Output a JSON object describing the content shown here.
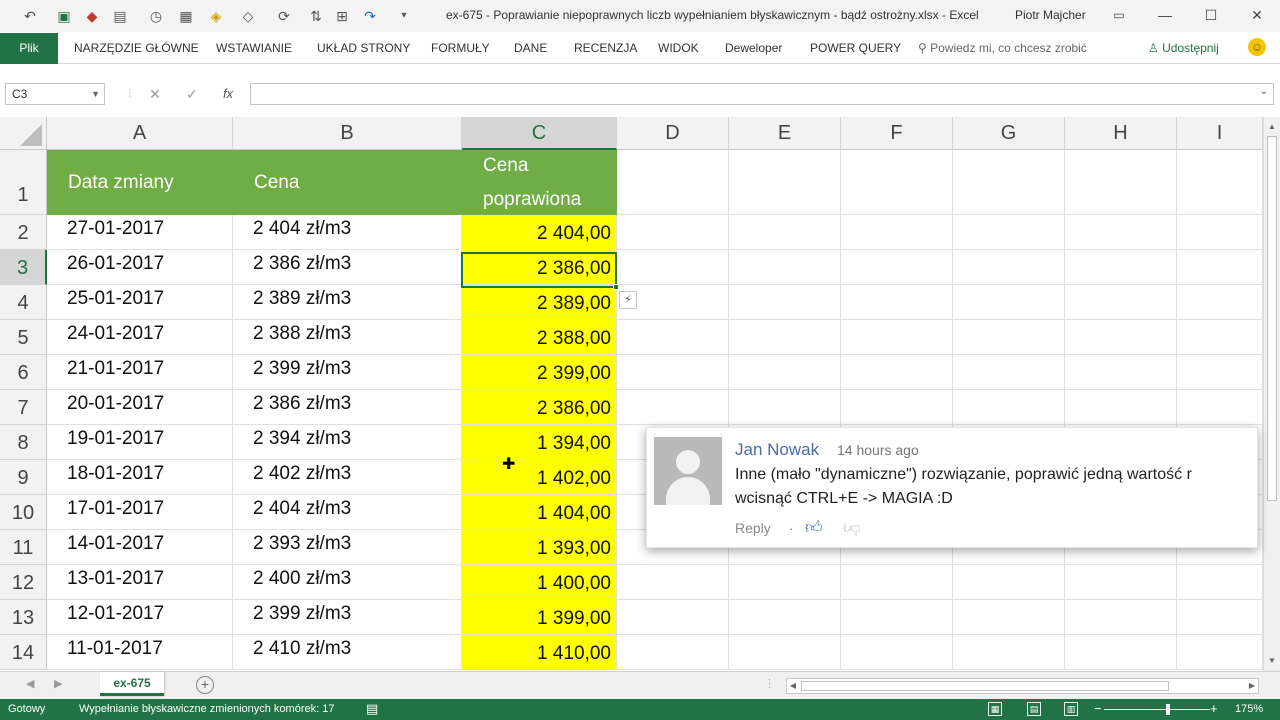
{
  "window": {
    "title": "ex-675 - Poprawianie niepoprawnych liczb wypełnianiem błyskawicznym - bądź ostrożny.xlsx  -  Excel",
    "user": "Piotr Majcher"
  },
  "ribbon": {
    "file": "Plik",
    "tabs": [
      "NARZĘDZIE GŁÓWNE",
      "WSTAWIANIE",
      "UKŁAD STRONY",
      "FORMUŁY",
      "DANE",
      "RECENZJA",
      "WIDOK",
      "Deweloper",
      "POWER QUERY"
    ],
    "tell_me": "Powiedz mi, co chcesz zrobić",
    "share": "Udostępnij"
  },
  "formula_bar": {
    "name_box": "C3",
    "cancel_glyph": "✕",
    "enter_glyph": "✓",
    "fx": "fx",
    "formula": ""
  },
  "columns": [
    "A",
    "B",
    "C",
    "D",
    "E",
    "F",
    "G",
    "H",
    "I"
  ],
  "selected_column": "C",
  "selected_row": 3,
  "sheet": {
    "header": {
      "a": "Data zmiany",
      "b": "Cena",
      "c1": "Cena",
      "c2": "poprawiona"
    },
    "rows": [
      {
        "n": 2,
        "a": "27-01-2017",
        "b": "2 404 zł/m3",
        "c": "2 404,00"
      },
      {
        "n": 3,
        "a": "26-01-2017",
        "b": "2 386 zł/m3",
        "c": "2 386,00"
      },
      {
        "n": 4,
        "a": "25-01-2017",
        "b": "2 389 zł/m3",
        "c": "2 389,00"
      },
      {
        "n": 5,
        "a": "24-01-2017",
        "b": "2 388 zł/m3",
        "c": "2 388,00"
      },
      {
        "n": 6,
        "a": "21-01-2017",
        "b": "2 399 zł/m3",
        "c": "2 399,00"
      },
      {
        "n": 7,
        "a": "20-01-2017",
        "b": "2 386 zł/m3",
        "c": "2 386,00"
      },
      {
        "n": 8,
        "a": "19-01-2017",
        "b": "2 394 zł/m3",
        "c": "1 394,00"
      },
      {
        "n": 9,
        "a": "18-01-2017",
        "b": "2 402 zł/m3",
        "c": "1 402,00"
      },
      {
        "n": 10,
        "a": "17-01-2017",
        "b": "2 404 zł/m3",
        "c": "1 404,00"
      },
      {
        "n": 11,
        "a": "14-01-2017",
        "b": "2 393 zł/m3",
        "c": "1 393,00"
      },
      {
        "n": 12,
        "a": "13-01-2017",
        "b": "2 400 zł/m3",
        "c": "1 400,00"
      },
      {
        "n": 13,
        "a": "12-01-2017",
        "b": "2 399 zł/m3",
        "c": "1 399,00"
      },
      {
        "n": 14,
        "a": "11-01-2017",
        "b": "2 410 zł/m3",
        "c": "1 410,00"
      }
    ]
  },
  "comment": {
    "author": "Jan Nowak",
    "time": "14 hours ago",
    "line1": "Inne (mało \"dynamiczne\") rozwiązanie, poprawić jedną wartość r",
    "line2": "wcisnąć CTRL+E -> MAGIA :D",
    "reply": "Reply",
    "separator": "·"
  },
  "sheet_tabs": {
    "active": "ex-675",
    "add_glyph": "+"
  },
  "status": {
    "ready": "Gotowy",
    "message": "Wypełnianie błyskawiczne zmienionych komórek: 17",
    "zoom": "175%",
    "zoom_minus": "−",
    "zoom_plus": "+"
  },
  "colors": {
    "excel_green": "#217346",
    "header_green": "#70ad47",
    "highlight_yellow": "#ffff00",
    "author_blue": "#4a6ca8"
  }
}
